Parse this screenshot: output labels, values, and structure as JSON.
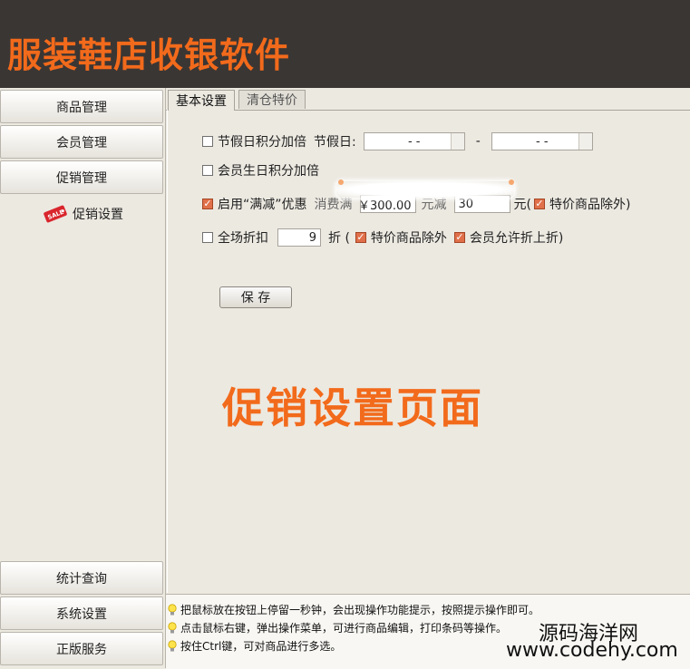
{
  "app": {
    "title": "服装鞋店收银软件"
  },
  "sidebar": {
    "top_items": [
      {
        "label": "商品管理"
      },
      {
        "label": "会员管理"
      },
      {
        "label": "促销管理"
      }
    ],
    "sub_item": {
      "label": "促销设置",
      "icon": "sale-tag-icon",
      "icon_text": "SALE"
    },
    "bottom_items": [
      {
        "label": "统计查询"
      },
      {
        "label": "系统设置"
      },
      {
        "label": "正版服务"
      }
    ]
  },
  "tabs": [
    {
      "label": "基本设置",
      "active": true
    },
    {
      "label": "清仓特价",
      "active": false
    }
  ],
  "form": {
    "holiday": {
      "label": "节假日积分加倍",
      "checked": false,
      "date_label": "节假日:",
      "start": "-  -",
      "separator": "-",
      "end": "-  -"
    },
    "birthday": {
      "label": "会员生日积分加倍",
      "checked": false
    },
    "full_reduction": {
      "label": "启用“满减”优惠",
      "checked": true,
      "spend_label": "消费满",
      "spend_value": "￥300.00",
      "reduce_label": "元减",
      "reduce_value": "30",
      "unit_label": "元(",
      "exclude_label": "特价商品除外)",
      "exclude_checked": true
    },
    "discount": {
      "label": "全场折扣",
      "checked": false,
      "value": "9",
      "unit_label": "折 (",
      "exclude_label": "特价商品除外",
      "exclude_checked": true,
      "member_label": "会员允许折上折)",
      "member_checked": true
    },
    "save_label": "保 存"
  },
  "overlay_text": "促销设置页面",
  "hints": [
    "把鼠标放在按钮上停留一秒钟，会出现操作功能提示，按照提示操作即可。",
    "点击鼠标右键，弹出操作菜单，可进行商品编辑，打印条码等操作。",
    "按住Ctrl键，可对商品进行多选。"
  ],
  "watermark": {
    "name": "源码海洋网",
    "url": "www.codehy.com"
  },
  "colors": {
    "accent": "#f26a1b",
    "header_bg": "#3a3634",
    "checkbox_checked": "#e0704a"
  }
}
